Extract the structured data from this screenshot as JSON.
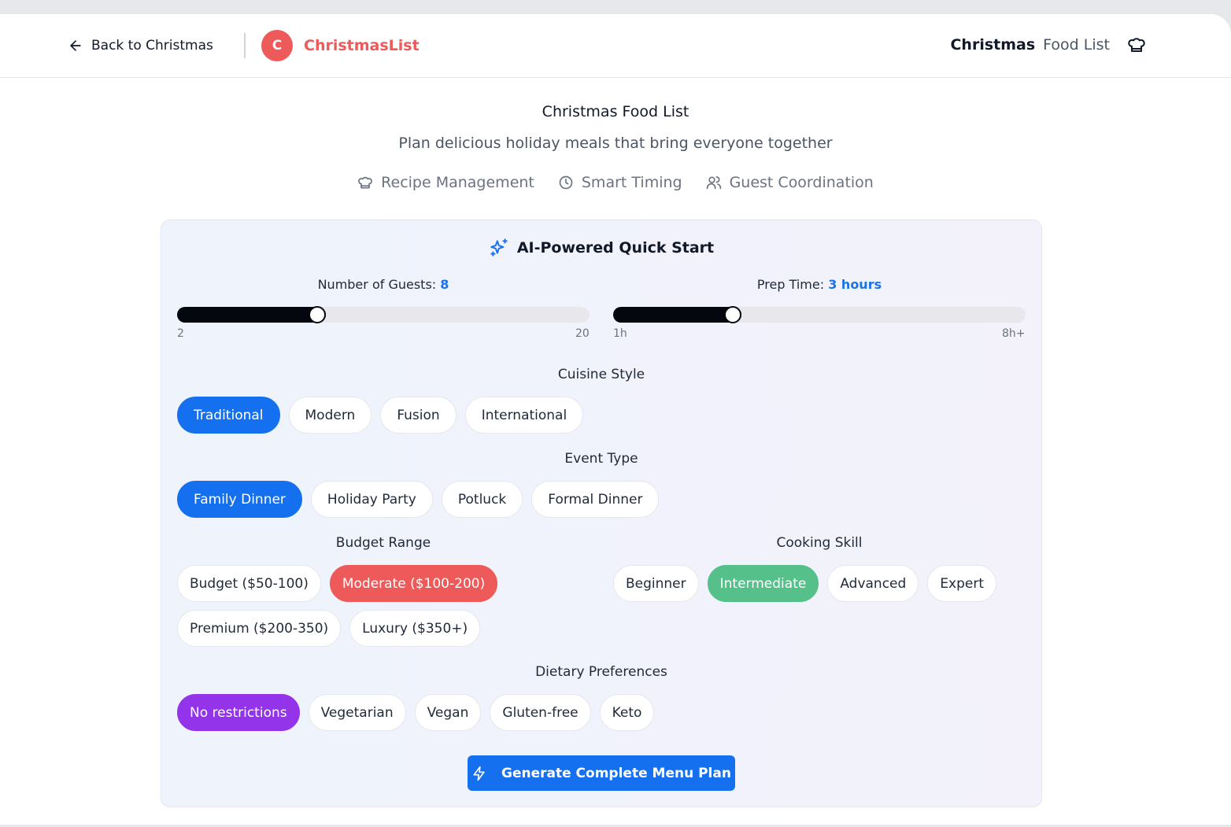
{
  "header": {
    "back_label": "Back to Christmas",
    "brand_initial": "C",
    "brand_name": "ChristmasList",
    "right_strong": "Christmas",
    "right_muted": "Food List"
  },
  "hero": {
    "title": "Christmas Food List",
    "subtitle": "Plan delicious holiday meals that bring everyone together",
    "features": [
      {
        "icon": "chef-hat-icon",
        "label": "Recipe Management"
      },
      {
        "icon": "clock-icon",
        "label": "Smart Timing"
      },
      {
        "icon": "users-icon",
        "label": "Guest Coordination"
      }
    ]
  },
  "quickstart": {
    "title": "AI-Powered Quick Start",
    "guests": {
      "label": "Number of Guests:",
      "value": "8",
      "min_label": "2",
      "max_label": "20",
      "fill_fraction": 0.34
    },
    "prep": {
      "label": "Prep Time:",
      "value": "3 hours",
      "min_label": "1h",
      "max_label": "8h+",
      "fill_fraction": 0.29
    },
    "cuisine": {
      "title": "Cuisine Style",
      "options": [
        "Traditional",
        "Modern",
        "Fusion",
        "International"
      ],
      "selected": "Traditional"
    },
    "event": {
      "title": "Event Type",
      "options": [
        "Family Dinner",
        "Holiday Party",
        "Potluck",
        "Formal Dinner"
      ],
      "selected": "Family Dinner"
    },
    "budget": {
      "title": "Budget Range",
      "options": [
        "Budget ($50-100)",
        "Moderate ($100-200)",
        "Premium ($200-350)",
        "Luxury ($350+)"
      ],
      "selected": "Moderate ($100-200)"
    },
    "skill": {
      "title": "Cooking Skill",
      "options": [
        "Beginner",
        "Intermediate",
        "Advanced",
        "Expert"
      ],
      "selected": "Intermediate"
    },
    "dietary": {
      "title": "Dietary Preferences",
      "options": [
        "No restrictions",
        "Vegetarian",
        "Vegan",
        "Gluten-free",
        "Keto"
      ],
      "selected": "No restrictions"
    },
    "generate_label": "Generate Complete Menu Plan"
  },
  "colors": {
    "brand_red": "#ee5a5a",
    "accent_blue": "#1570ef",
    "success_green": "#56c08a",
    "purple": "#9333ea"
  }
}
